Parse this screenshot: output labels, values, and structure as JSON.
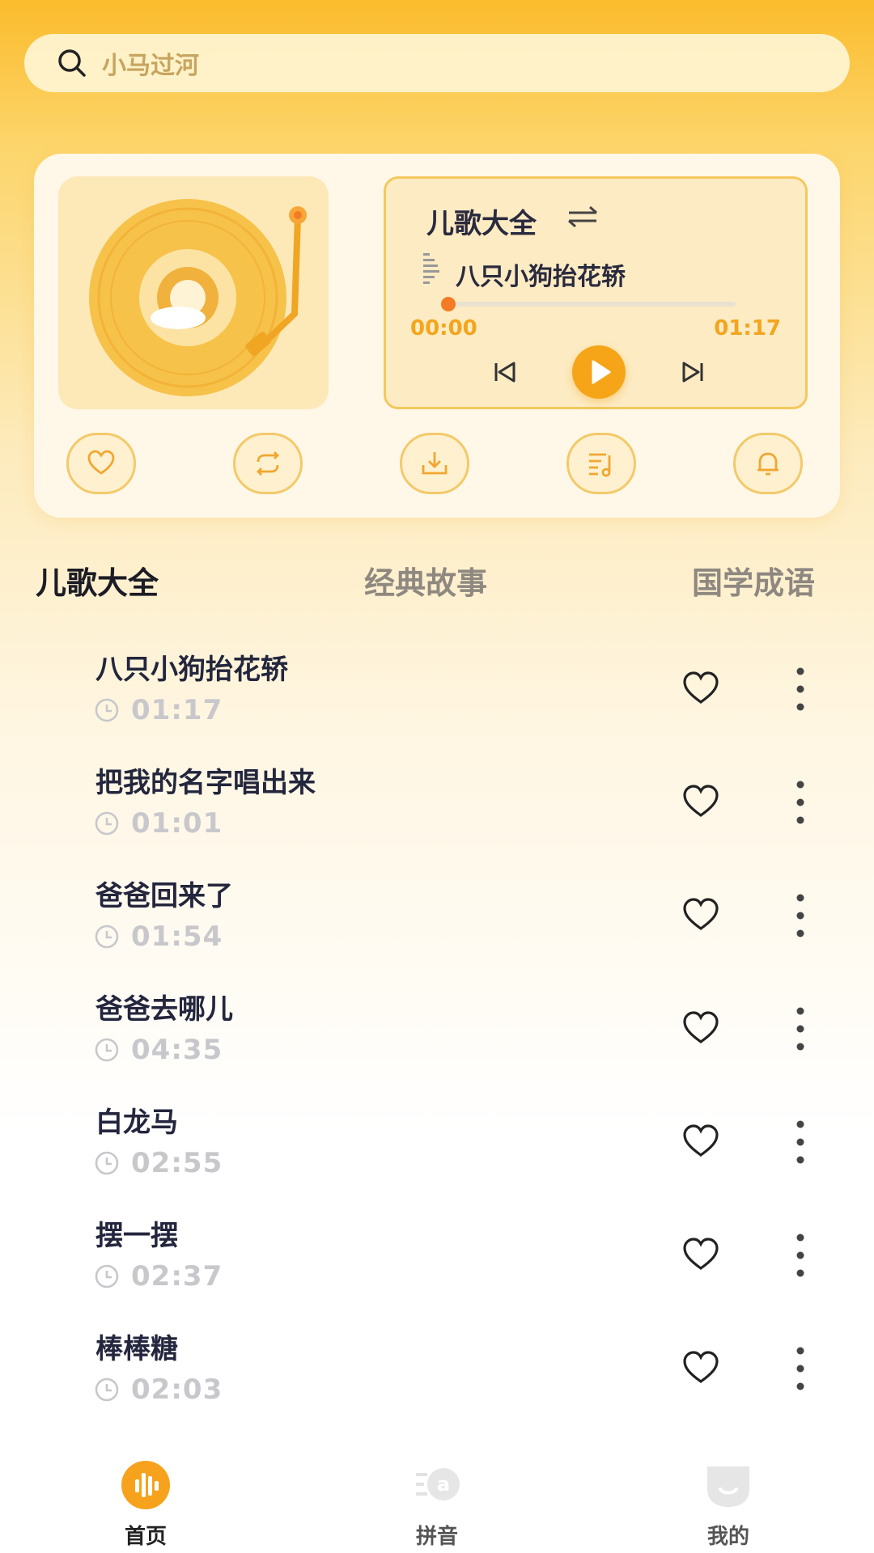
{
  "search": {
    "placeholder": "小马过河"
  },
  "player": {
    "playlist": "儿歌大全",
    "song": "八只小狗抬花轿",
    "current_time": "00:00",
    "total_time": "01:17",
    "progress": 0.0,
    "actions": [
      "heart-icon",
      "repeat-icon",
      "download-icon",
      "playlist-icon",
      "bell-icon"
    ]
  },
  "tabs": [
    {
      "label": "儿歌大全",
      "active": true
    },
    {
      "label": "经典故事",
      "active": false
    },
    {
      "label": "国学成语",
      "active": false
    }
  ],
  "songs": [
    {
      "title": "八只小狗抬花轿",
      "duration": "01:17"
    },
    {
      "title": "把我的名字唱出来",
      "duration": "01:01"
    },
    {
      "title": "爸爸回来了",
      "duration": "01:54"
    },
    {
      "title": "爸爸去哪儿",
      "duration": "04:35"
    },
    {
      "title": "白龙马",
      "duration": "02:55"
    },
    {
      "title": "摆一摆",
      "duration": "02:37"
    },
    {
      "title": "棒棒糖",
      "duration": "02:03"
    }
  ],
  "nav": [
    {
      "label": "首页",
      "active": true,
      "icon": "home-equalizer-icon"
    },
    {
      "label": "拼音",
      "active": false,
      "icon": "pinyin-icon"
    },
    {
      "label": "我的",
      "active": false,
      "icon": "profile-icon"
    }
  ],
  "colors": {
    "accent": "#f6a519",
    "text": "#23263d",
    "muted": "#c8c8cc"
  }
}
